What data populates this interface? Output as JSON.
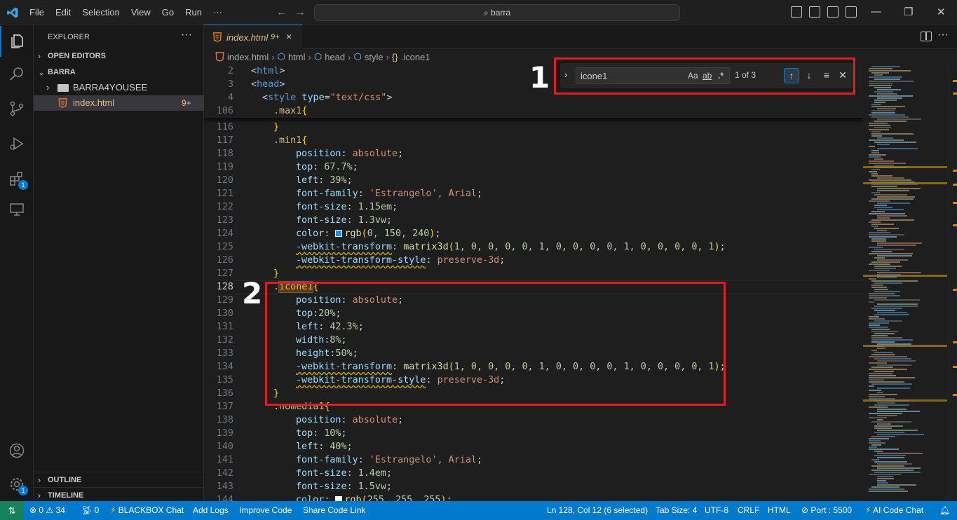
{
  "menu": [
    "File",
    "Edit",
    "Selection",
    "View",
    "Go",
    "Run",
    "···"
  ],
  "command_center": {
    "text": "barra"
  },
  "sidebar": {
    "title": "EXPLORER",
    "more": "···",
    "open_editors": "OPEN EDITORS",
    "folder": "BARRA",
    "subfolder": "BARRA4YOUSEE",
    "file": "index.html",
    "file_badge": "9+",
    "outline": "OUTLINE",
    "timeline": "TIMELINE"
  },
  "activity": {
    "extensions_badge": "1",
    "settings_badge": "1"
  },
  "tab": {
    "label": "index.html",
    "modified": "9+",
    "close": "×"
  },
  "breadcrumb": [
    "index.html",
    "html",
    "head",
    "style",
    ".icone1"
  ],
  "find": {
    "value": "icone1",
    "match_case": "Aa",
    "whole_word": "ab",
    "regex": ".*",
    "count": "1 of 3"
  },
  "annotations": {
    "one": "1",
    "two": "2"
  },
  "code": {
    "sticky": [
      {
        "n": "2",
        "t": "<html>"
      },
      {
        "n": "3",
        "t": "<head>"
      },
      {
        "n": "4",
        "t": "<style type=\"text/css\">"
      },
      {
        "n": "106",
        "t": ".max1{"
      }
    ],
    "lines": [
      {
        "n": "116",
        "t": "}"
      },
      {
        "n": "117",
        "t": ".min1{"
      },
      {
        "n": "118",
        "t": "position: absolute;"
      },
      {
        "n": "119",
        "t": "top: 67.7%;"
      },
      {
        "n": "120",
        "t": "left: 39%;"
      },
      {
        "n": "121",
        "t": "font-family: 'Estrangelo', Arial;"
      },
      {
        "n": "122",
        "t": "font-size: 1.15em;"
      },
      {
        "n": "123",
        "t": "font-size: 1.3vw;"
      },
      {
        "n": "124",
        "t": "color: rgb(0, 150, 240);"
      },
      {
        "n": "125",
        "t": "-webkit-transform: matrix3d(1, 0, 0, 0, 0, 1, 0, 0, 0, 0, 1, 0, 0, 0, 0, 1);"
      },
      {
        "n": "126",
        "t": "-webkit-transform-style: preserve-3d;"
      },
      {
        "n": "127",
        "t": "}"
      },
      {
        "n": "128",
        "t": ".icone1{"
      },
      {
        "n": "129",
        "t": "position: absolute;"
      },
      {
        "n": "130",
        "t": "top:20%;"
      },
      {
        "n": "131",
        "t": "left: 42.3%;"
      },
      {
        "n": "132",
        "t": "width:8%;"
      },
      {
        "n": "133",
        "t": "height:50%;"
      },
      {
        "n": "134",
        "t": "-webkit-transform: matrix3d(1, 0, 0, 0, 0, 1, 0, 0, 0, 0, 1, 0, 0, 0, 0, 1);"
      },
      {
        "n": "135",
        "t": "-webkit-transform-style: preserve-3d;"
      },
      {
        "n": "136",
        "t": "}"
      },
      {
        "n": "137",
        "t": ".nomedia1{"
      },
      {
        "n": "138",
        "t": "position: absolute;"
      },
      {
        "n": "139",
        "t": "top: 10%;"
      },
      {
        "n": "140",
        "t": "left: 40%;"
      },
      {
        "n": "141",
        "t": "font-family: 'Estrangelo', Arial;"
      },
      {
        "n": "142",
        "t": "font-size: 1.4em;"
      },
      {
        "n": "143",
        "t": "font-size: 1.5vw;"
      },
      {
        "n": "144",
        "t": "color: rgb(255, 255, 255);"
      }
    ]
  },
  "status": {
    "errors": "0",
    "warnings": "34",
    "ports": "0",
    "blackbox": "BLACKBOX Chat",
    "add_logs": "Add Logs",
    "improve": "Improve Code",
    "share": "Share Code Link",
    "position": "Ln 128, Col 12 (6 selected)",
    "tab_size": "Tab Size: 4",
    "encoding": "UTF-8",
    "eol": "CRLF",
    "language": "HTML",
    "port": "Port : 5500",
    "ai_chat": "AI Code Chat"
  },
  "colors": {
    "accent": "#0078d4",
    "statusbar": "#007acc",
    "annotation": "#e01e1e",
    "modified": "#e2c08d"
  }
}
